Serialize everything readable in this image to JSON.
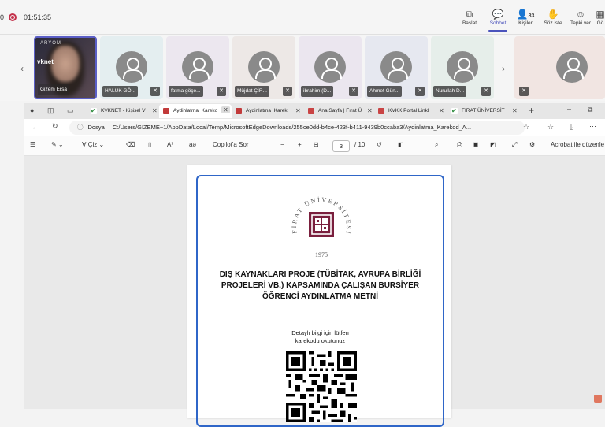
{
  "meeting": {
    "rec_partial": "0",
    "recording_time": "01:51:35",
    "controls": [
      {
        "label": "Başlat",
        "icon": "share-screen-icon"
      },
      {
        "label": "Sohbet",
        "icon": "chat-icon"
      },
      {
        "label": "Kişiler",
        "icon": "people-icon",
        "count": "83"
      },
      {
        "label": "Söz iste",
        "icon": "raise-hand-icon"
      },
      {
        "label": "Tepki ver",
        "icon": "react-icon"
      },
      {
        "label": "Gö",
        "icon": "view-icon"
      }
    ],
    "participants": [
      {
        "name": "Gizem Ersa",
        "video": true,
        "brand": "ARYOM",
        "brand2": "vknet"
      },
      {
        "name": "HALUK GÖ..."
      },
      {
        "name": "fatma göçe..."
      },
      {
        "name": "Müjdat ÇİR..."
      },
      {
        "name": "ibrahim (D..."
      },
      {
        "name": "Ahmet Gün..."
      },
      {
        "name": "Nurullah D..."
      },
      {
        "name": ""
      }
    ]
  },
  "browser": {
    "tabs": [
      {
        "title": "KVKNET - Kişisel V",
        "favicon": "green-check"
      },
      {
        "title": "Aydinlatma_Kareko",
        "favicon": "pdf",
        "active": true
      },
      {
        "title": "Aydinlatma_Karek",
        "favicon": "pdf"
      },
      {
        "title": "Ana Sayfa | Fırat Ü",
        "favicon": "red"
      },
      {
        "title": "KVKK Portal Linkl",
        "favicon": "red"
      },
      {
        "title": "FIRAT ÜNİVERSİT",
        "favicon": "green-check"
      }
    ],
    "address_label": "Dosya",
    "url": "C:/Users/GIZEME~1/AppData/Local/Temp/MicrosoftEdgeDownloads/255ce0dd-b4ce-423f-b411-9439b0ccaba3/Aydinlatma_Karekod_A...",
    "pdf_toolbar": {
      "draw_label": "Çiz",
      "copilot_label": "Copilot'a Sor",
      "page_current": "3",
      "page_total": "/ 10",
      "acrobat_label": "Acrobat ile düzenle"
    }
  },
  "document": {
    "seal_text": "FIRAT ÜNİVERSİTESİ",
    "seal_year": "1975",
    "title_lines": [
      "DIŞ KAYNAKLARI PROJE (TÜBİTAK, AVRUPA BİRLİĞİ",
      "PROJELERİ VB.) KAPSAMINDA ÇALIŞAN BURSİYER",
      "ÖĞRENCİ AYDINLATMA METNİ"
    ],
    "note_lines": [
      "Detaylı bilgi için lütfen",
      "karekodu okutunuz"
    ]
  },
  "colors": {
    "accent": "#4b53bc",
    "record": "#c4314b",
    "seal": "#7a1f3d",
    "frame": "#2f66c8"
  }
}
